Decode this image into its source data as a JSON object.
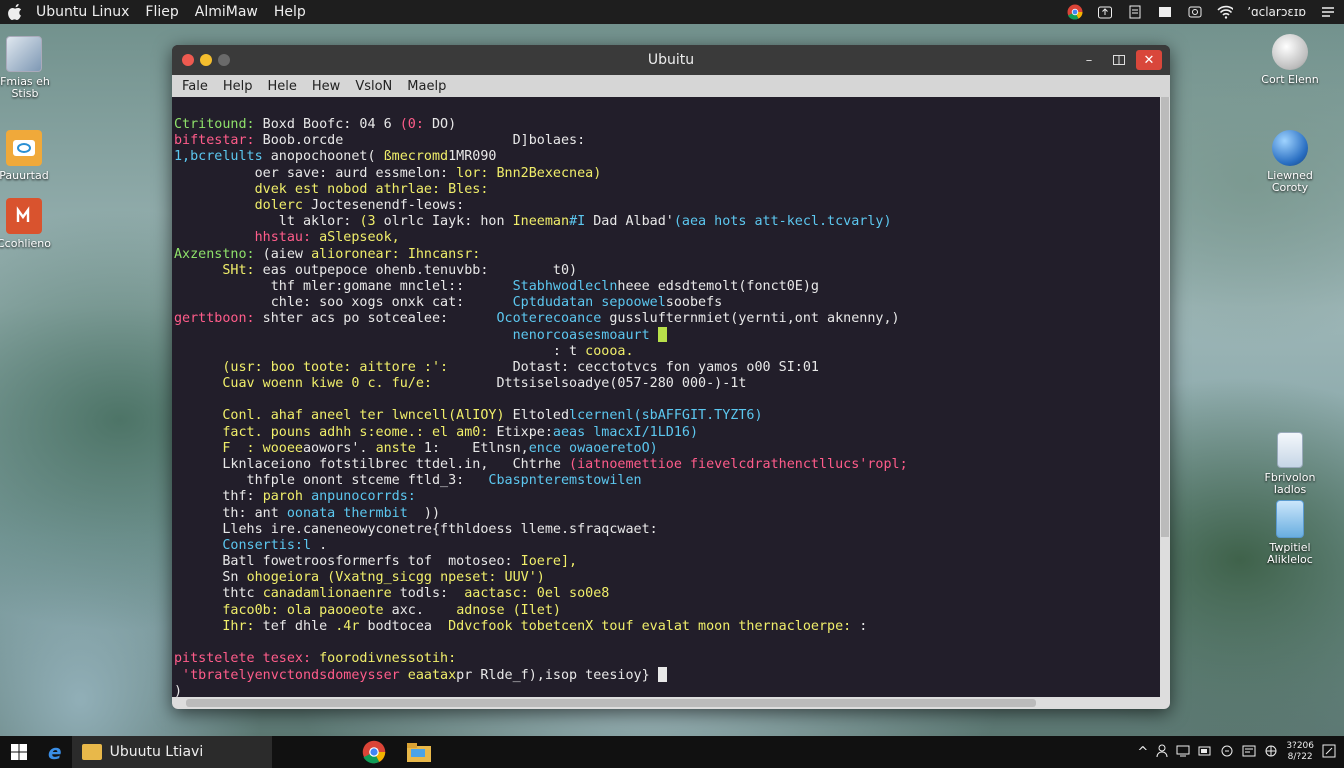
{
  "topbar": {
    "menus": [
      "Ubuntu Linux",
      "Fliep",
      "AlmiMaw",
      "Help"
    ],
    "clock": "ʼɑclarɔɛɪɒ"
  },
  "desktop_icons": {
    "left": [
      {
        "label": "Fmias eh Stisb",
        "icon": "drive-icon"
      },
      {
        "label": "Pauurtad",
        "icon": "disc-icon"
      },
      {
        "label": "Ccohlieno",
        "icon": "office-icon"
      }
    ],
    "right": [
      {
        "label": "Cort Elenn",
        "icon": "disk-icon"
      },
      {
        "label": "Liewned Coroty",
        "icon": "globe-icon"
      },
      {
        "label": "Fbrivolon Iadlos",
        "icon": "doc-icon"
      },
      {
        "label": "Twpitiel Alikleloc",
        "icon": "file-icon"
      }
    ]
  },
  "window": {
    "title": "Ubuitu",
    "menus": [
      "Fale",
      "Help",
      "Hele",
      "Hew",
      "VsloN",
      "Maelp"
    ]
  },
  "terminal": {
    "lines": [
      [
        [
          "g",
          "Ctritound:"
        ],
        [
          "w",
          " Boxd Boofc: 04 6 "
        ],
        [
          "r",
          "(0:"
        ],
        [
          "w",
          " DO)"
        ]
      ],
      [
        [
          "r",
          "biftestar:"
        ],
        [
          "w",
          " Boob.orcde                     D]bolaes:"
        ]
      ],
      [
        [
          "c",
          "1,bcrelults"
        ],
        [
          "w",
          " anopochoonet( "
        ],
        [
          "y",
          "ßmecromd"
        ],
        [
          "w",
          "1MR090"
        ]
      ],
      [
        [
          "w",
          "          oer save: aurd essmelon: "
        ],
        [
          "y",
          "lor:"
        ],
        [
          "w",
          " "
        ],
        [
          "y",
          "Bnn2Bexecnea)"
        ]
      ],
      [
        [
          "w",
          "          "
        ],
        [
          "y",
          "dvek est nobod athrlae: Bles:"
        ]
      ],
      [
        [
          "w",
          "          "
        ],
        [
          "y",
          "dolerc"
        ],
        [
          "w",
          " Joctesenendf-leows:"
        ]
      ],
      [
        [
          "w",
          "             lt aklor: "
        ],
        [
          "y",
          "(3"
        ],
        [
          "w",
          " olrlc Iayk: hon "
        ],
        [
          "y",
          "Ineeman"
        ],
        [
          "c",
          "#I"
        ],
        [
          "w",
          " Dad Albad'"
        ],
        [
          "c",
          "(aea hots att-kecl.tcvarly)"
        ]
      ],
      [
        [
          "w",
          "          "
        ],
        [
          "r",
          "hhstau:"
        ],
        [
          "w",
          " "
        ],
        [
          "y",
          "aSlepseok,"
        ]
      ],
      [
        [
          "g",
          "Axzenstno:"
        ],
        [
          "w",
          " (aiew "
        ],
        [
          "y",
          "alioronear:"
        ],
        [
          "w",
          " "
        ],
        [
          "y",
          "Ihncansr:"
        ]
      ],
      [
        [
          "w",
          "      "
        ],
        [
          "y",
          "SHt:"
        ],
        [
          "w",
          " eas outpepoce ohenb.tenuvbb:        t0)"
        ]
      ],
      [
        [
          "w",
          "            thf mler:gomane mnclel::      "
        ],
        [
          "c",
          "Stabhwodlecln"
        ],
        [
          "w",
          "heee edsdtemolt(fonct0E)g"
        ]
      ],
      [
        [
          "w",
          "            chle: soo xogs onxk cat:      "
        ],
        [
          "c",
          "Cptdudatan sepoowel"
        ],
        [
          "w",
          "soobefs"
        ]
      ],
      [
        [
          "r",
          "gerttboon:"
        ],
        [
          "w",
          " shter acs po sotcealee:      "
        ],
        [
          "c",
          "Ocoterecoance"
        ],
        [
          "w",
          " gusslufternmiet(yernti,ont aknenny,)"
        ]
      ],
      [
        [
          "w",
          "                                          "
        ],
        [
          "c",
          "nenorcoasesmoaurt"
        ],
        [
          "w",
          " "
        ],
        [
          "cur",
          "g"
        ]
      ],
      [
        [
          "w",
          "                                               : t "
        ],
        [
          "y",
          "coooa."
        ]
      ],
      [
        [
          "w",
          "      "
        ],
        [
          "y",
          "(usr:"
        ],
        [
          "w",
          " "
        ],
        [
          "y",
          "boo toote: aittore :':"
        ],
        [
          "w",
          "        Dotast: cecctotvcs fon yamos o00 SI:01"
        ]
      ],
      [
        [
          "w",
          "      "
        ],
        [
          "y",
          "Cuav woenn kiwe 0 c. fu/e:"
        ],
        [
          "w",
          "        Dttsiselsoadye(057-280 000-)-1t"
        ]
      ],
      [
        [
          "w",
          "",
          ""
        ]
      ],
      [
        [
          "w",
          "      "
        ],
        [
          "y",
          "Conl. ahaf aneel ter lwncell(AlIOY)"
        ],
        [
          "w",
          " Eltoled"
        ],
        [
          "c",
          "lcernenl(sbAFFGIT.TYZT6)"
        ]
      ],
      [
        [
          "w",
          "      "
        ],
        [
          "y",
          "fact. pouns adhh s:eome.: el am0:"
        ],
        [
          "w",
          " Etixpe:"
        ],
        [
          "c",
          "aeas lmacxI/1LD16)"
        ]
      ],
      [
        [
          "w",
          "      "
        ],
        [
          "y",
          "F  : wooee"
        ],
        [
          "w",
          "aowors'. "
        ],
        [
          "y",
          "anste"
        ],
        [
          "w",
          " 1:    Etlnsn,"
        ],
        [
          "c",
          "ence owaoeretoO)"
        ]
      ],
      [
        [
          "w",
          "      Lknlaceiono fotstilbrec ttdel.in,   Chtrhe "
        ],
        [
          "r",
          "(iatnoemettioe fievelcdrathenctllucs'ropl;"
        ]
      ],
      [
        [
          "w",
          "         thfple onont stceme ftld_3:   "
        ],
        [
          "c",
          "Cbaspnteremstowilen"
        ]
      ],
      [
        [
          "w",
          "      thf: "
        ],
        [
          "y",
          "paroh"
        ],
        [
          "w",
          " "
        ],
        [
          "c",
          "anpunocorrds:"
        ]
      ],
      [
        [
          "w",
          "      th: ant "
        ],
        [
          "c",
          "oonata thermbit"
        ],
        [
          "w",
          "  ))"
        ]
      ],
      [
        [
          "w",
          "      Llehs ire.caneneowycone"
        ],
        [
          "w",
          "tre{fthldoess lleme.sfraqcwaet:"
        ]
      ],
      [
        [
          "w",
          "      "
        ],
        [
          "c",
          "Consertis:l"
        ],
        [
          "w",
          " ."
        ]
      ],
      [
        [
          "w",
          "      Batl fowetroosformerfs tof  motoseo: "
        ],
        [
          "y",
          "Ioere],"
        ]
      ],
      [
        [
          "w",
          "      Sn "
        ],
        [
          "y",
          "ohogeiora (Vxatng_sicgg"
        ],
        [
          "w",
          " "
        ],
        [
          "y",
          "npeset: UUV')"
        ]
      ],
      [
        [
          "w",
          "      thtc "
        ],
        [
          "y",
          "canadamlionaenre"
        ],
        [
          "w",
          " todls:  "
        ],
        [
          "y",
          "aactasc: 0el so0e8"
        ]
      ],
      [
        [
          "w",
          "      "
        ],
        [
          "y",
          "faco0b: ola paooeote"
        ],
        [
          "w",
          " axc.    "
        ],
        [
          "y",
          "adnose (Ilet)"
        ]
      ],
      [
        [
          "w",
          "      "
        ],
        [
          "y",
          "Ihr:"
        ],
        [
          "w",
          " tef dhle "
        ],
        [
          "y",
          ".4r"
        ],
        [
          "w",
          " bodtocea  "
        ],
        [
          "y",
          "Ddvcfook tobetcenX touf"
        ],
        [
          "w",
          " "
        ],
        [
          "y",
          "evalat moon thernacloerpe:"
        ],
        [
          "w",
          " :"
        ]
      ],
      [
        [
          "w",
          "",
          ""
        ]
      ],
      [
        [
          "r",
          "pitstelete tesex:"
        ],
        [
          "w",
          " "
        ],
        [
          "y",
          "foorodivnessotih:"
        ]
      ],
      [
        [
          "r",
          " 'tbratelyenvctondsdomeysser"
        ],
        [
          "w",
          " "
        ],
        [
          "y",
          "eaatax"
        ],
        [
          "w",
          "pr Rlde_f),isop teesioy} "
        ],
        [
          "cur",
          "w"
        ]
      ],
      [
        [
          "w",
          ")"
        ]
      ]
    ]
  },
  "taskbar": {
    "active_item": "Ubuutu Ltiavi",
    "clock_time": "3?206",
    "clock_date": "8/?22"
  }
}
